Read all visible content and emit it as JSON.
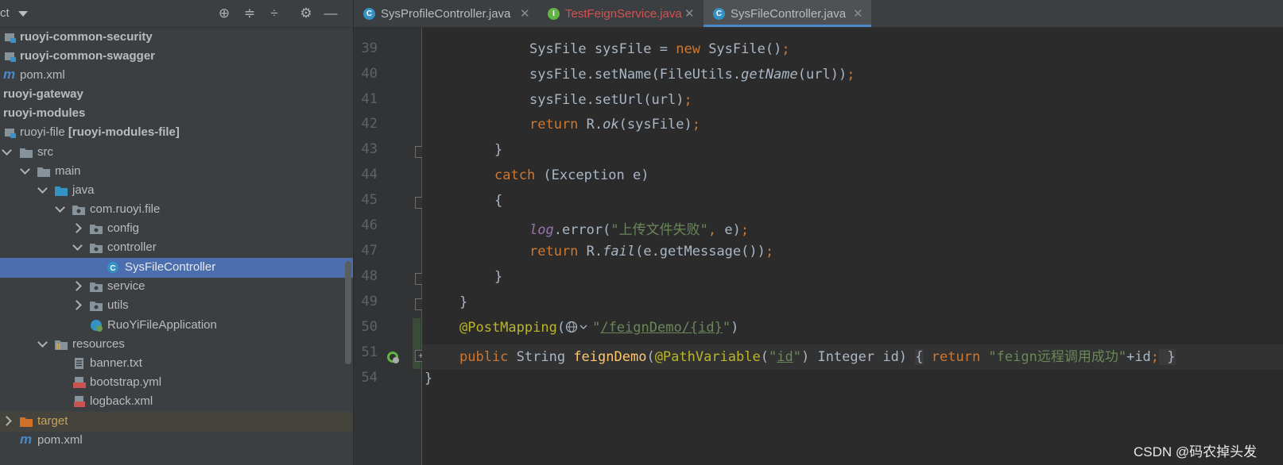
{
  "project_panel": {
    "title": "ct",
    "header_icons": [
      "locate-icon",
      "expand-all-icon",
      "collapse-all-icon",
      "gear-icon",
      "minimize-icon"
    ],
    "tree": [
      {
        "label": "ruoyi-common-security",
        "bold": true,
        "icon": "module-icon"
      },
      {
        "label": "ruoyi-common-swagger",
        "bold": true,
        "icon": "module-icon"
      },
      {
        "label": "pom.xml",
        "icon": "maven-icon"
      },
      {
        "label": "ruoyi-gateway",
        "bold": true
      },
      {
        "label": "ruoyi-modules",
        "bold": true
      },
      {
        "label": "ruoyi-file",
        "suffix": "[ruoyi-modules-file]",
        "icon": "module-icon"
      },
      {
        "label": "src",
        "icon": "folder-icon"
      },
      {
        "label": "main",
        "icon": "folder-icon"
      },
      {
        "label": "java",
        "icon": "source-folder-icon"
      },
      {
        "label": "com.ruoyi.file",
        "icon": "package-icon"
      },
      {
        "label": "config",
        "icon": "package-icon"
      },
      {
        "label": "controller",
        "icon": "package-icon"
      },
      {
        "label": "SysFileController",
        "icon": "class-icon",
        "selected": true
      },
      {
        "label": "service",
        "icon": "package-icon"
      },
      {
        "label": "utils",
        "icon": "package-icon"
      },
      {
        "label": "RuoYiFileApplication",
        "icon": "spring-boot-app-icon"
      },
      {
        "label": "resources",
        "icon": "resources-folder-icon"
      },
      {
        "label": "banner.txt",
        "icon": "text-file-icon"
      },
      {
        "label": "bootstrap.yml",
        "icon": "yml-file-icon"
      },
      {
        "label": "logback.xml",
        "icon": "xml-file-icon"
      },
      {
        "label": "target",
        "icon": "excluded-folder-icon"
      },
      {
        "label": "pom.xml",
        "icon": "maven-icon"
      }
    ]
  },
  "tabs": [
    {
      "label": "SysProfileController.java",
      "icon": "class-icon",
      "active": false
    },
    {
      "label": "TestFeignService.java",
      "icon": "interface-icon",
      "active": false
    },
    {
      "label": "SysFileController.java",
      "icon": "class-icon",
      "active": true
    }
  ],
  "editor": {
    "line_numbers": [
      "39",
      "40",
      "41",
      "42",
      "43",
      "44",
      "45",
      "46",
      "47",
      "48",
      "49",
      "50",
      "51",
      "54"
    ],
    "code": {
      "l39": {
        "t1": "SysFile sysFile = ",
        "kw": "new",
        "t2": " SysFile()",
        "semi": ";"
      },
      "l40": {
        "t1": "sysFile.setName(FileUtils.",
        "it": "getName",
        "t2": "(url))",
        "semi": ";"
      },
      "l41": {
        "t1": "sysFile.setUrl(url)",
        "semi": ";"
      },
      "l42": {
        "kw": "return",
        "t1": " R.",
        "it": "ok",
        "t2": "(sysFile)",
        "semi": ";"
      },
      "l43": {
        "t1": "}"
      },
      "l44": {
        "kw": "catch",
        "t1": " (Exception e)"
      },
      "l45": {
        "t1": "{"
      },
      "l46": {
        "field": "log",
        "t1": ".error(",
        "str": "\"上传文件失败\"",
        "comma": ",",
        "t2": " e)",
        "semi": ";"
      },
      "l47": {
        "kw": "return",
        "t1": " R.",
        "it": "fail",
        "t2": "(e.getMessage())",
        "semi": ";"
      },
      "l48": {
        "t1": "}"
      },
      "l49": {
        "t1": "}"
      },
      "l50": {
        "ann": "@PostMapping",
        "t1": "(",
        "str1": "\"",
        "str2": "/feignDemo/{id}",
        "str3": "\"",
        "t2": ")"
      },
      "l51": {
        "kw1": "public",
        "t1": " String ",
        "fn": "feignDemo",
        "t2": "(",
        "ann": "@PathVariable",
        "t3": "(",
        "str1": "\"",
        "str2": "id",
        "str3": "\"",
        "t4": ") Integer id) ",
        "b1": "{",
        "kw2": " return",
        "str4": " \"feign远程调用成功\"",
        "t5": "+id",
        "semi": ";",
        "b2": " }"
      },
      "l54": {
        "t1": "}"
      }
    }
  },
  "watermark": "CSDN @码农掉头发",
  "colors": {
    "selection": "#4b6eaf",
    "keyword": "#cc7832",
    "string": "#6a8759",
    "annotation": "#bbb529",
    "function": "#ffc66d"
  }
}
